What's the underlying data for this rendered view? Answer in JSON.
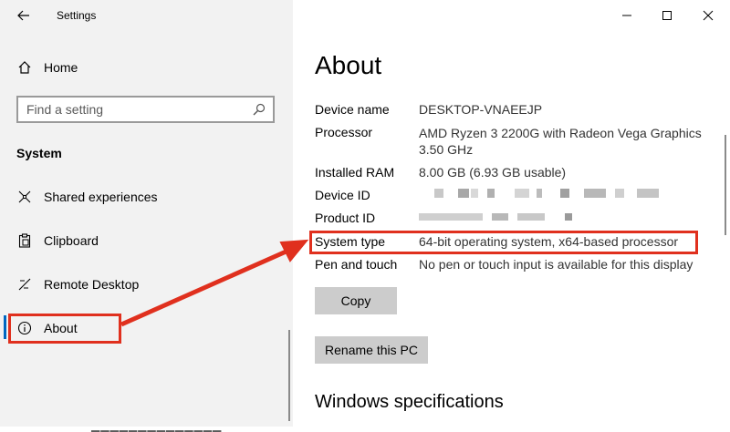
{
  "app": {
    "title": "Settings"
  },
  "sidebar": {
    "home_label": "Home",
    "search_placeholder": "Find a setting",
    "section_title": "System",
    "items": [
      {
        "label": "Shared experiences",
        "icon": "shared-experiences-icon"
      },
      {
        "label": "Clipboard",
        "icon": "clipboard-icon"
      },
      {
        "label": "Remote Desktop",
        "icon": "remote-desktop-icon"
      },
      {
        "label": "About",
        "icon": "info-icon",
        "active": true
      }
    ]
  },
  "main": {
    "title": "About",
    "specs": [
      {
        "label": "Device name",
        "value": "DESKTOP-VNAEEJP"
      },
      {
        "label": "Processor",
        "value": "AMD Ryzen 3 2200G with Radeon Vega Graphics 3.50 GHz"
      },
      {
        "label": "Installed RAM",
        "value": "8.00 GB (6.93 GB usable)"
      },
      {
        "label": "Device ID",
        "value": ""
      },
      {
        "label": "Product ID",
        "value": ""
      },
      {
        "label": "System type",
        "value": "64-bit operating system, x64-based processor"
      },
      {
        "label": "Pen and touch",
        "value": "No pen or touch input is available for this display"
      }
    ],
    "copy_button": "Copy",
    "rename_button": "Rename this PC",
    "windows_specs_heading": "Windows specifications"
  },
  "colors": {
    "accent": "#0067c0",
    "annotation": "#e0301e",
    "sidebar_bg": "#f2f2f2",
    "button_bg": "#cccccc"
  }
}
